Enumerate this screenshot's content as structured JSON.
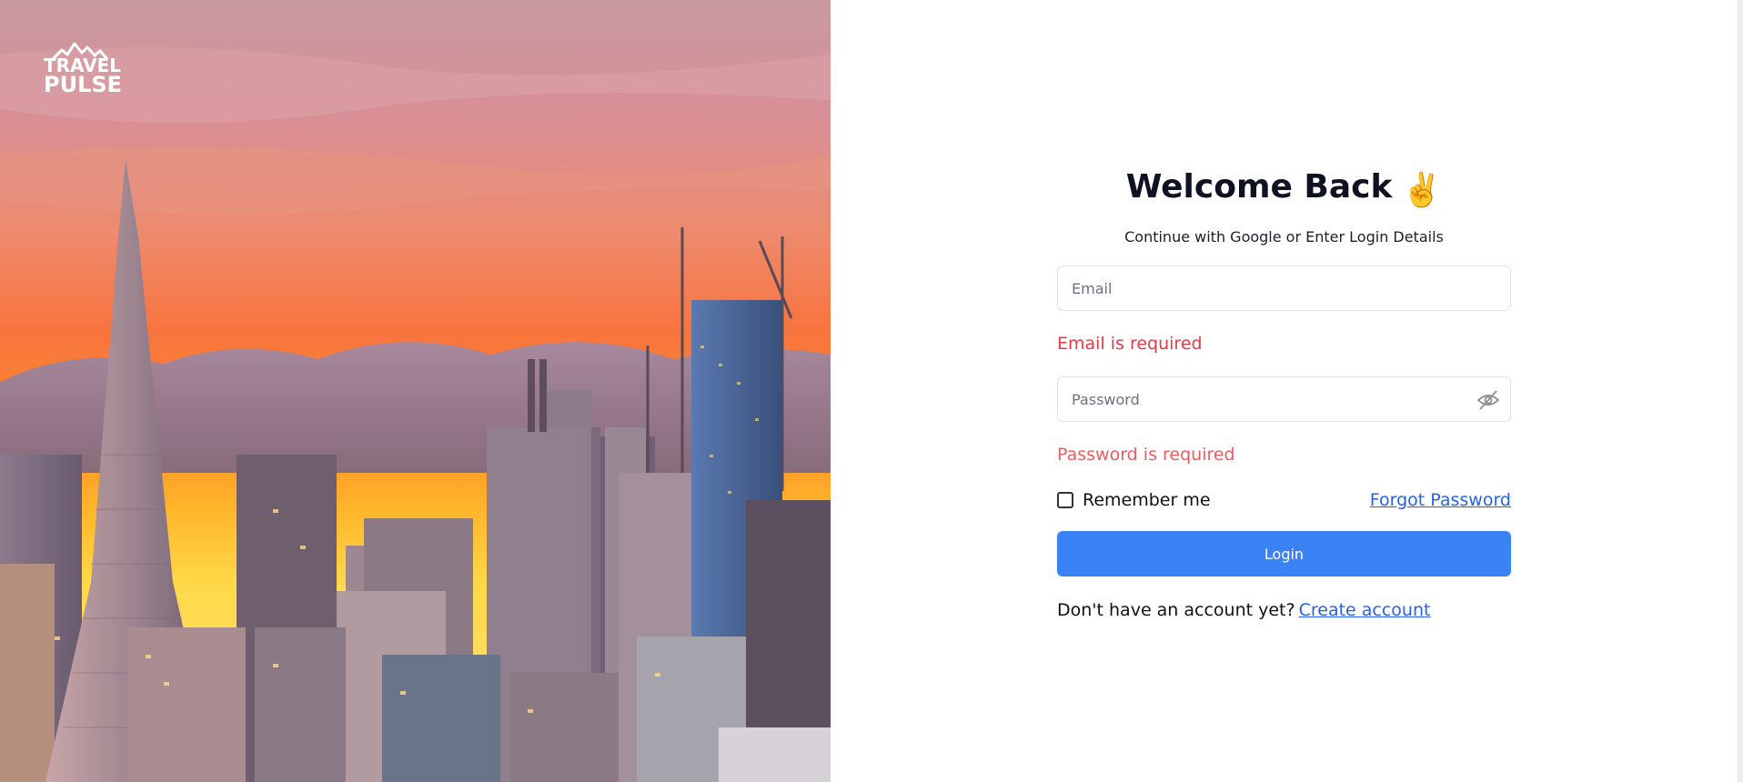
{
  "brand": {
    "line1": "TRAVEL",
    "line2": "PULSE"
  },
  "form": {
    "title": "Welcome Back",
    "title_emoji": "✌️",
    "subtitle": "Continue with Google or Enter Login Details",
    "email": {
      "placeholder": "Email",
      "value": "",
      "error": "Email is required"
    },
    "password": {
      "placeholder": "Password",
      "value": "",
      "error": "Password is required",
      "toggle_icon": "eye-off-icon"
    },
    "remember_label": "Remember me",
    "remember_checked": false,
    "forgot_label": "Forgot Password",
    "login_label": "Login",
    "signup_prompt": "Don't have an account yet?",
    "signup_link": "Create account"
  },
  "colors": {
    "primary": "#3b82f6",
    "link": "#2762e6",
    "error": "#e53946",
    "title": "#0f1222"
  }
}
